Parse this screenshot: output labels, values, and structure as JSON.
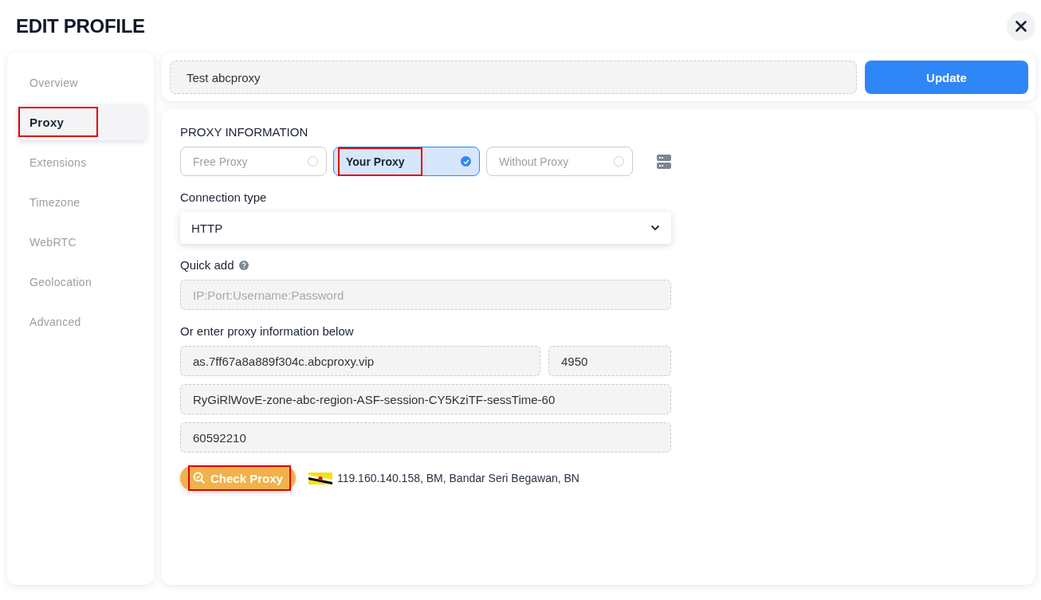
{
  "title": "EDIT PROFILE",
  "sidebar": {
    "items": [
      {
        "label": "Overview",
        "selected": false,
        "highlighted": false
      },
      {
        "label": "Proxy",
        "selected": true,
        "highlighted": true
      },
      {
        "label": "Extensions",
        "selected": false,
        "highlighted": false
      },
      {
        "label": "Timezone",
        "selected": false,
        "highlighted": false
      },
      {
        "label": "WebRTC",
        "selected": false,
        "highlighted": false
      },
      {
        "label": "Geolocation",
        "selected": false,
        "highlighted": false
      },
      {
        "label": "Advanced",
        "selected": false,
        "highlighted": false
      }
    ]
  },
  "profile_name": {
    "value": "Test abcproxy"
  },
  "update_button": {
    "label": "Update"
  },
  "proxy_information": {
    "heading": "PROXY INFORMATION",
    "options": [
      {
        "label": "Free Proxy",
        "selected": false,
        "highlighted": false
      },
      {
        "label": "Your Proxy",
        "selected": true,
        "highlighted": true
      },
      {
        "label": "Without Proxy",
        "selected": false,
        "highlighted": false
      }
    ],
    "connection_type": {
      "label": "Connection type",
      "value": "HTTP"
    },
    "quick_add": {
      "label": "Quick add",
      "placeholder": "IP:Port:Username:Password"
    },
    "manual": {
      "label": "Or enter proxy information below",
      "host": "as.7ff67a8a889f304c.abcproxy.vip",
      "port": "4950",
      "username": "RyGiRlWovE-zone-abc-region-ASF-session-CY5KziTF-sessTime-60",
      "password": "60592210"
    },
    "check_button": {
      "label": "Check Proxy",
      "highlighted": true
    },
    "check_result": "119.160.140.158, BM, Bandar Seri Begawan, BN"
  }
}
